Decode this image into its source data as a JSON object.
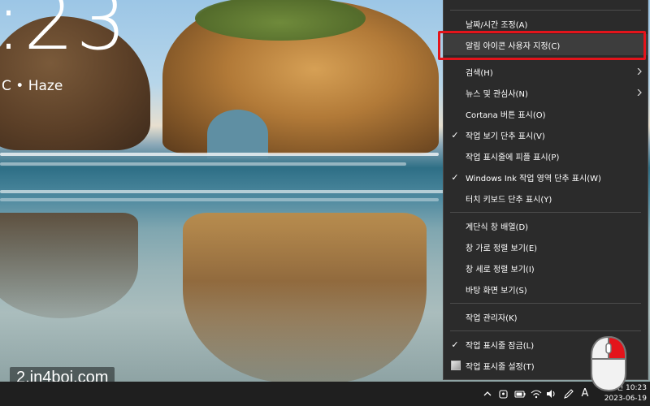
{
  "lock_screen": {
    "time": ":23",
    "weather": "C • Haze"
  },
  "watermark": "2.in4boi.com",
  "context_menu": {
    "items": [
      {
        "label": "날짜/시간 조정(A)",
        "checked": false,
        "submenu": false
      },
      {
        "label": "알림 아이콘 사용자 지정(C)",
        "checked": false,
        "submenu": false,
        "highlighted": true
      },
      {
        "label": "검색(H)",
        "checked": false,
        "submenu": true
      },
      {
        "label": "뉴스 및 관심사(N)",
        "checked": false,
        "submenu": true
      },
      {
        "label": "Cortana 버튼 표시(O)",
        "checked": false,
        "submenu": false
      },
      {
        "label": "작업 보기 단추 표시(V)",
        "checked": true,
        "submenu": false
      },
      {
        "label": "작업 표시줄에 피플 표시(P)",
        "checked": false,
        "submenu": false
      },
      {
        "label": "Windows Ink 작업 영역 단추 표시(W)",
        "checked": true,
        "submenu": false
      },
      {
        "label": "터치 키보드 단추 표시(Y)",
        "checked": false,
        "submenu": false
      },
      {
        "label": "계단식 창 배열(D)",
        "checked": false,
        "submenu": false
      },
      {
        "label": "창 가로 정렬 보기(E)",
        "checked": false,
        "submenu": false
      },
      {
        "label": "창 세로 정렬 보기(I)",
        "checked": false,
        "submenu": false
      },
      {
        "label": "바탕 화면 보기(S)",
        "checked": false,
        "submenu": false
      },
      {
        "label": "작업 관리자(K)",
        "checked": false,
        "submenu": false
      },
      {
        "label": "작업 표시줄 잠금(L)",
        "checked": true,
        "submenu": false
      },
      {
        "label": "작업 표시줄 설정(T)",
        "checked": false,
        "submenu": false,
        "icon": "settings-icon"
      }
    ],
    "check_glyph": "✓"
  },
  "taskbar": {
    "tray": {
      "icons": [
        "chevron-up-icon",
        "meet-now-icon",
        "battery-icon",
        "wifi-icon",
        "volume-icon",
        "pen-icon",
        "ime-icon"
      ],
      "ime_label": "A"
    },
    "clock": {
      "time": "오전 10:23",
      "date": "2023-06-19"
    }
  },
  "colors": {
    "menu_bg": "#2b2b2b",
    "highlight_border": "#e3141b",
    "taskbar_bg": "#1f1f1f",
    "mouse_button": "#e3141b"
  }
}
